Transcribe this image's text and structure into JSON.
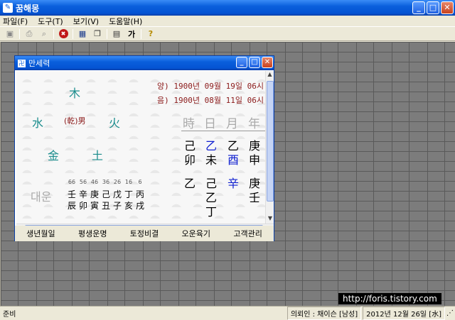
{
  "app": {
    "title": "꿈해몽"
  },
  "menu": [
    "파일(F)",
    "도구(T)",
    "보기(V)",
    "도움말(H)"
  ],
  "child": {
    "title": "만세력",
    "elements": {
      "wood": "木",
      "water": "水",
      "fire": "火",
      "metal": "金",
      "earth": "土",
      "center": "(乾)男"
    },
    "solar": "양) 1900년 09월 19일 06시",
    "lunar": "음) 1900년 08월 11일 06시",
    "pillars_head": [
      "時",
      "日",
      "月",
      "年"
    ],
    "stems": [
      "己",
      "乙",
      "乙",
      "庚"
    ],
    "branches": [
      "卯",
      "未",
      "酉",
      "申"
    ],
    "hidden1": [
      "乙",
      "己",
      "辛",
      "庚"
    ],
    "hidden2": [
      "乙",
      "壬"
    ],
    "hidden3": "丁",
    "daeun_label": "대운",
    "ages": [
      "66",
      "56",
      "46",
      "36",
      "26",
      "16",
      "6"
    ],
    "daeun_stems": [
      "壬",
      "辛",
      "庚",
      "己",
      "戊",
      "丁",
      "丙"
    ],
    "daeun_branches": [
      "辰",
      "卯",
      "寅",
      "丑",
      "子",
      "亥",
      "戌"
    ],
    "bottom_menu": [
      "생년월일",
      "평생운명",
      "토정비결",
      "오운육기",
      "고객관리"
    ]
  },
  "status": {
    "ready": "준비",
    "client": "의뢰인 : 채이슨 [남성]",
    "date": "2012년 12월 26일 [水]"
  },
  "watermark": "http://foris.tistory.com",
  "colors": {
    "element": "#1a8c8c",
    "date": "#8b1a1a",
    "highlight": "#1020d0"
  }
}
